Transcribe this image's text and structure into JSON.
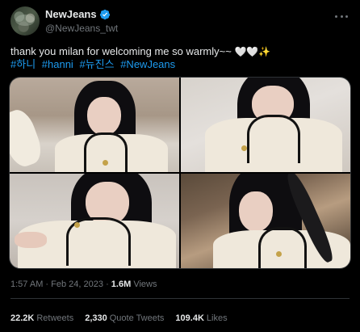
{
  "tweet": {
    "author": {
      "display_name": "NewJeans",
      "handle": "@NewJeans_twt",
      "verified": true
    },
    "text": "thank you milan for welcoming me so warmly~~",
    "text_emoji": "🤍🤍✨",
    "hashtags": [
      "#하니",
      "#hanni",
      "#뉴진스",
      "#NewJeans"
    ],
    "media": [
      {
        "alt": "photo-1"
      },
      {
        "alt": "photo-2"
      },
      {
        "alt": "photo-3"
      },
      {
        "alt": "photo-4"
      }
    ],
    "time": "1:57 AM",
    "date": "Feb 24, 2023",
    "separator": "·",
    "views_count": "1.6M",
    "views_label": "Views",
    "stats": {
      "retweets_count": "22.2K",
      "retweets_label": "Retweets",
      "quotes_count": "2,330",
      "quotes_label": "Quote Tweets",
      "likes_count": "109.4K",
      "likes_label": "Likes"
    }
  },
  "colors": {
    "background": "#000000",
    "text": "#e7e9ea",
    "secondary": "#71767b",
    "link": "#1d9bf0",
    "border": "#2f3336"
  }
}
